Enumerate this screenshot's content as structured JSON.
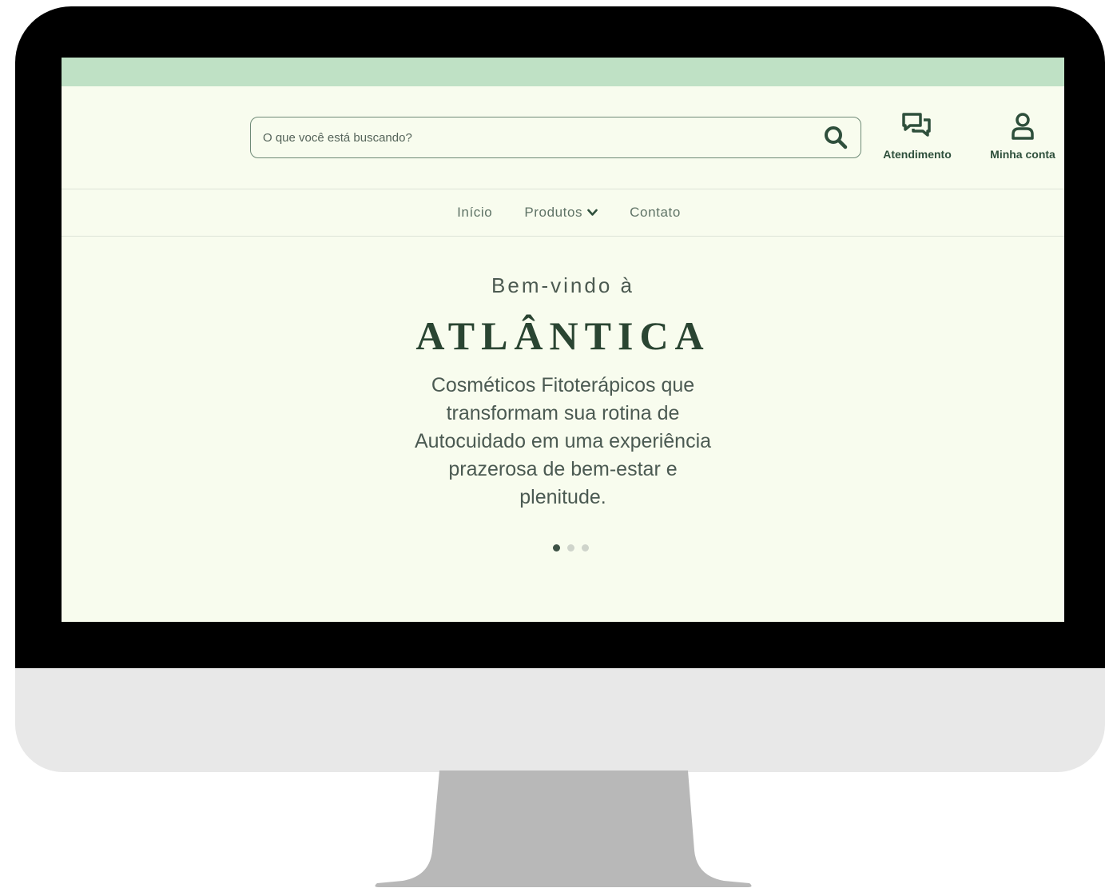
{
  "search": {
    "placeholder": "O que você está buscando?"
  },
  "header": {
    "support_label": "Atendimento",
    "account_label": "Minha conta"
  },
  "nav": {
    "items": [
      {
        "label": "Início"
      },
      {
        "label": "Produtos"
      },
      {
        "label": "Contato"
      }
    ]
  },
  "hero": {
    "welcome": "Bem-vindo à",
    "brand": "ATLÂNTICA",
    "tagline": "Cosméticos Fitoterápicos que transformam sua rotina de Autocuidado em uma experiência prazerosa de bem-estar e plenitude."
  },
  "carousel": {
    "total_slides": 3,
    "active_slide": 1
  },
  "colors": {
    "top_bar": "#bfe1c5",
    "background": "#f8fcee",
    "brand_green": "#2a4532"
  },
  "icons": {
    "search": "search-icon",
    "support": "chat-bubbles-icon",
    "account": "user-icon",
    "dropdown": "chevron-down-icon"
  }
}
